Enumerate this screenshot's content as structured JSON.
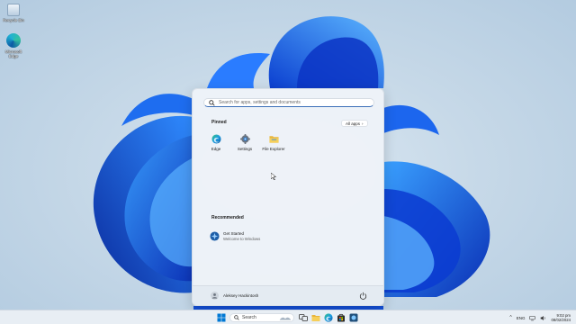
{
  "desktop": {
    "icons": [
      {
        "label": "Recycle Bin"
      },
      {
        "label": "Microsoft Edge"
      }
    ]
  },
  "start_menu": {
    "search_placeholder": "Search for apps, settings and documents",
    "pinned_title": "Pinned",
    "all_apps_label": "All apps",
    "all_apps_chevron": "›",
    "pinned_apps": [
      {
        "label": "Edge",
        "icon": "edge-icon"
      },
      {
        "label": "Settings",
        "icon": "gear-icon"
      },
      {
        "label": "File Explorer",
        "icon": "folder-icon"
      }
    ],
    "recommended_title": "Recommended",
    "recommended": [
      {
        "name": "Get Started",
        "subtitle": "Welcome to Windows",
        "icon": "get-started-icon"
      }
    ],
    "user_name": "Aleksey Hackintosh",
    "power_icon": "power-icon"
  },
  "taskbar": {
    "search_label": "Search",
    "tray": {
      "chevron": "^",
      "language": "ENG",
      "time": "9:02 pm",
      "date": "08/02/2024"
    }
  },
  "colors": {
    "accent": "#0067c0",
    "bloom_dark": "#0a2fb5",
    "bloom_light": "#2f8bff",
    "start_menu_bg": "#eef3f8"
  }
}
